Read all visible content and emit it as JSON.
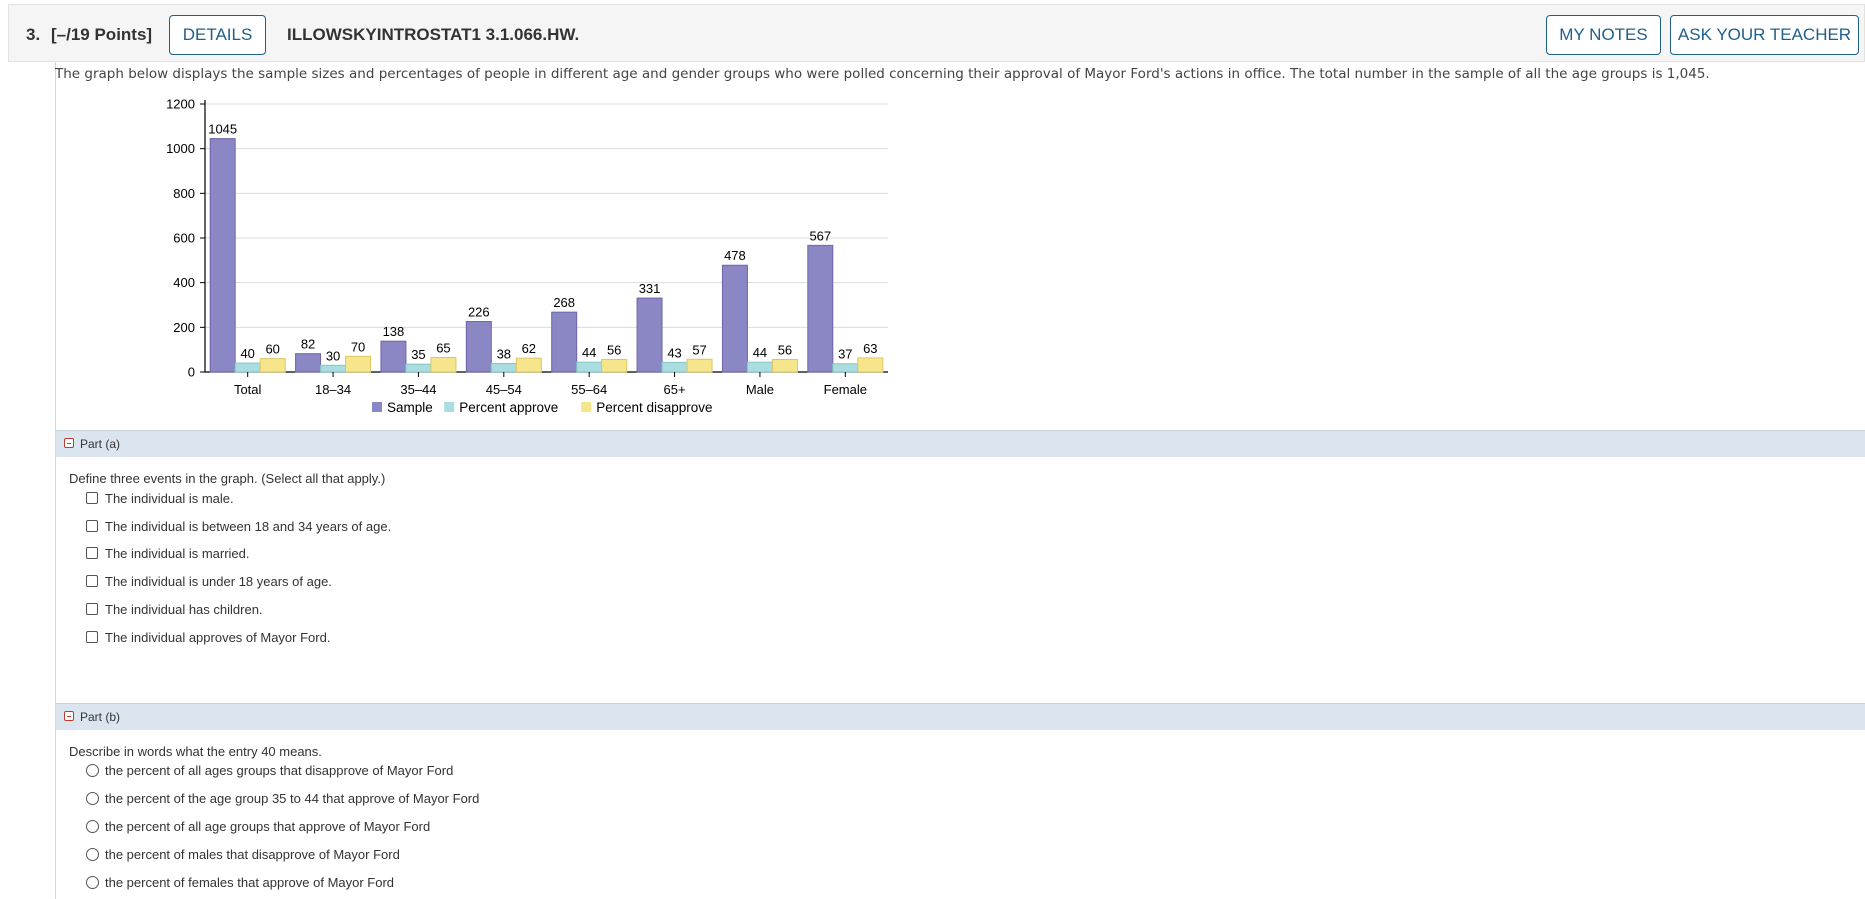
{
  "header": {
    "number": "3.",
    "points": "[–/19 Points]",
    "details_label": "DETAILS",
    "code": "ILLOWSKYINTROSTAT1 3.1.066.HW.",
    "my_notes_label": "MY NOTES",
    "ask_teacher_label": "ASK YOUR TEACHER"
  },
  "intro": "The graph below displays the sample sizes and percentages of people in different age and gender groups who were polled concerning their approval of Mayor Ford's actions in office. The total number in the sample of all the age groups is 1,045.",
  "chart_data": {
    "type": "bar",
    "categories": [
      "Total",
      "18–34",
      "35–44",
      "45–54",
      "55–64",
      "65+",
      "Male",
      "Female"
    ],
    "series": [
      {
        "name": "Sample",
        "color": "#8b86c4",
        "values": [
          1045,
          82,
          138,
          226,
          268,
          331,
          478,
          567
        ]
      },
      {
        "name": "Percent approve",
        "color": "#a9dde0",
        "values": [
          40,
          30,
          35,
          38,
          44,
          43,
          44,
          37
        ]
      },
      {
        "name": "Percent disapprove",
        "color": "#f7e58c",
        "values": [
          60,
          70,
          65,
          62,
          56,
          57,
          56,
          63
        ]
      }
    ],
    "ylim": [
      0,
      1200
    ],
    "yticks": [
      0,
      200,
      400,
      600,
      800,
      1000,
      1200
    ],
    "grid": true,
    "legend": "bottom"
  },
  "part_a": {
    "title": "Part (a)",
    "prompt": "Define three events in the graph. (Select all that apply.)",
    "options": [
      "The individual is male.",
      "The individual is between 18 and 34 years of age.",
      "The individual is married.",
      "The individual is under 18 years of age.",
      "The individual has children.",
      "The individual approves of Mayor Ford."
    ]
  },
  "part_b": {
    "title": "Part (b)",
    "prompt": "Describe in words what the entry 40 means.",
    "options": [
      "the percent of all ages groups that disapprove of Mayor Ford",
      "the percent of the age group 35 to 44 that approve of Mayor Ford",
      "the percent of all age groups that approve of Mayor Ford",
      "the percent of males that disapprove of Mayor Ford",
      "the percent of females that approve of Mayor Ford"
    ]
  }
}
